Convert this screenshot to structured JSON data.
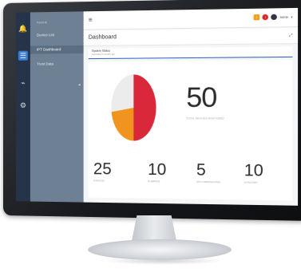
{
  "sidebar": {
    "section_title": "Assets",
    "items": [
      {
        "label": "Device List"
      },
      {
        "label": "IPT Dashboard"
      },
      {
        "label": "Trust Data"
      }
    ],
    "rail_icons": [
      "bell-icon",
      "list-icon",
      "activity-icon",
      "gear-icon"
    ]
  },
  "topbar": {
    "user_name": "Admin"
  },
  "page": {
    "title": "Dashboard"
  },
  "status": {
    "title": "System Status",
    "subtitle": "Generated 5 minutes ago"
  },
  "chart_data": {
    "type": "pie",
    "title": "",
    "slices": [
      {
        "value": 50,
        "color": "#d8283a"
      },
      {
        "value": 23,
        "color": "#f0941f"
      },
      {
        "value": 27,
        "color": "#ececec"
      }
    ]
  },
  "summary": {
    "big_value": "50",
    "big_caption": "TOTAL DEVICES MONITORED",
    "stats": [
      {
        "value": "25",
        "caption": "IN REGION"
      },
      {
        "value": "10",
        "caption": "IN SERVICE"
      },
      {
        "value": "5",
        "caption": "NOT COMMUNICATING"
      },
      {
        "value": "10",
        "caption": "IN FACTORY"
      }
    ]
  },
  "colors": {
    "rail": "#253448",
    "nav": "#6e8194",
    "accent": "#2a63c7"
  }
}
